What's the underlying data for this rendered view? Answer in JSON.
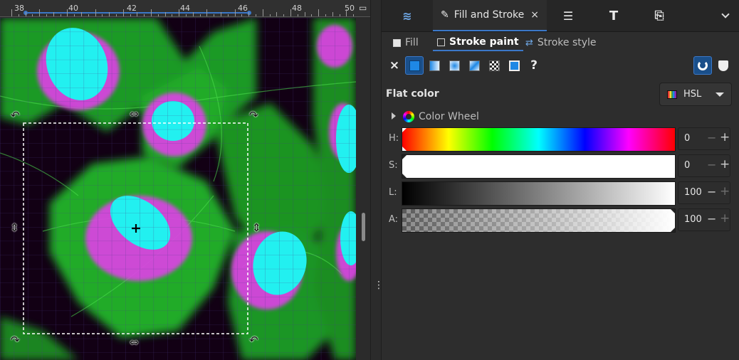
{
  "ruler": {
    "numbers": [
      "38",
      "40",
      "42",
      "44",
      "46",
      "48",
      "50"
    ]
  },
  "dialog_tabs": [
    {
      "name": "layers-objects",
      "icon": "layers-icon"
    },
    {
      "name": "fill-and-stroke",
      "label": "Fill and Stroke",
      "close": "×",
      "icon": "pen-icon"
    },
    {
      "name": "align-distribute",
      "icon": "align-icon"
    },
    {
      "name": "text-font",
      "icon": "T"
    },
    {
      "name": "export",
      "icon": "export-icon"
    }
  ],
  "sub_tabs": {
    "fill": "Fill",
    "stroke_paint": "Stroke paint",
    "stroke_style": "Stroke style"
  },
  "paint_buttons": {
    "none": "×",
    "unset": "?"
  },
  "flat": {
    "label": "Flat color",
    "mode": "HSL"
  },
  "color_wheel": {
    "label": "Color Wheel"
  },
  "sliders": [
    {
      "channel": "H:",
      "value": "0"
    },
    {
      "channel": "S:",
      "value": "0"
    },
    {
      "channel": "L:",
      "value": "100"
    },
    {
      "channel": "A:",
      "value": "100"
    }
  ],
  "colors": {
    "accent": "#3b78c8",
    "selected_swatch": "#1e88e5",
    "cells_green": "#22c02a",
    "cells_magenta": "#e040e8",
    "cells_cyan": "#22f0f0"
  }
}
